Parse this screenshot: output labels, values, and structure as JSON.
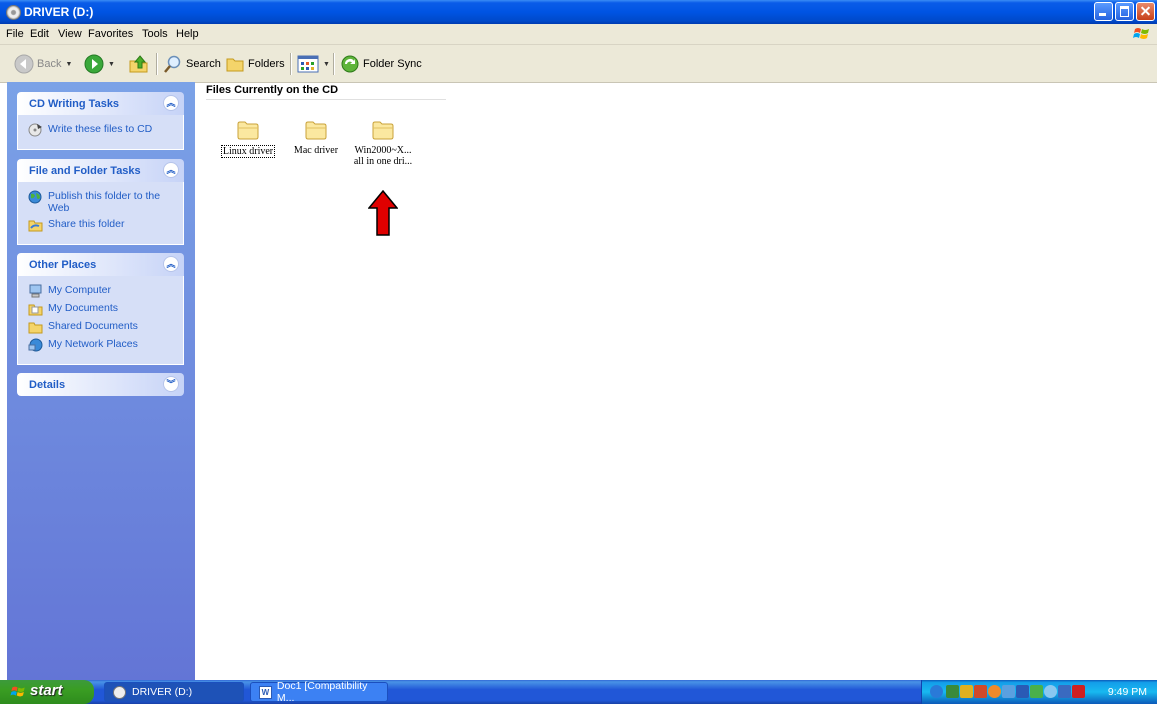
{
  "window": {
    "title": "DRIVER (D:)"
  },
  "menu": [
    "File",
    "Edit",
    "View",
    "Favorites",
    "Tools",
    "Help"
  ],
  "toolbar": {
    "back": "Back",
    "search": "Search",
    "folders": "Folders",
    "folder_sync": "Folder Sync"
  },
  "left_pane": {
    "panels": [
      {
        "title": "CD Writing Tasks",
        "items": [
          "Write these files to CD"
        ]
      },
      {
        "title": "File and Folder Tasks",
        "items": [
          "Publish this folder to the Web",
          "Share this folder"
        ]
      },
      {
        "title": "Other Places",
        "items": [
          "My Computer",
          "My Documents",
          "Shared Documents",
          "My Network Places"
        ]
      },
      {
        "title": "Details",
        "items": []
      }
    ]
  },
  "main": {
    "group_header": "Files Currently on the CD",
    "items": [
      {
        "name": "Linux driver",
        "selected": true
      },
      {
        "name": "Mac driver",
        "selected": false
      },
      {
        "name_line1": "Win2000~X...",
        "name_line2": "all in one dri...",
        "selected": false
      }
    ],
    "annotation_color": "#e00000"
  },
  "taskbar": {
    "start": "start",
    "tasks": [
      "DRIVER (D:)",
      "Doc1 [Compatibility M..."
    ],
    "clock": "9:49 PM"
  },
  "colors": {
    "titlebar": "#0054e3",
    "pane_link": "#215dc6",
    "start_green": "#3a9d23"
  }
}
